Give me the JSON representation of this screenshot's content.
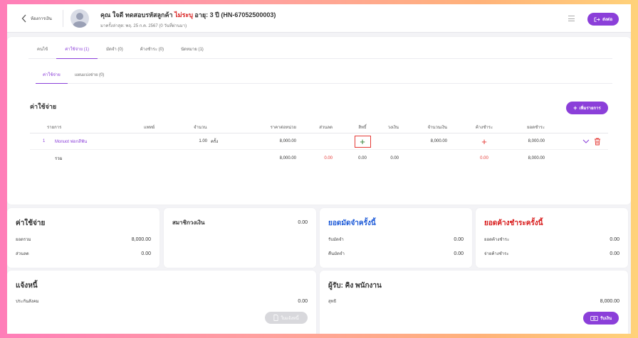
{
  "header": {
    "back_label": "ห้องการเงิน",
    "patient_name_prefix": "คุณ ใจดี ทดสอบรหัสลูกค้า ",
    "patient_flag": "ไม่ระบุ",
    "patient_name_suffix": " อายุ: 3 ปี (HN-67052500003)",
    "last_visit": "มาครั้งล่าสุด: พฤ. 25 ก.ค. 2567 (0 วันที่ผ่านมา)",
    "send_label": "ส่งต่อ"
  },
  "tabs_main": [
    {
      "label": "คนไข้"
    },
    {
      "label": "ค่าใช้จ่าย (1)"
    },
    {
      "label": "มัดจำ (0)"
    },
    {
      "label": "ค้างชำระ (0)"
    },
    {
      "label": "นัดหมาย (1)"
    }
  ],
  "tabs_sub": [
    {
      "label": "ค่าใช้จ่าย"
    },
    {
      "label": "แผนแบ่งจ่าย (0)"
    }
  ],
  "expenses": {
    "title": "ค่าใช้จ่าย",
    "add_label": "เพิ่มรายการ",
    "columns": {
      "item": "รายการ",
      "doctor": "แพทย์",
      "qty": "จำนวน",
      "unit_price": "ราคาต่อหน่วย",
      "discount": "ส่วนลด",
      "rights": "สิทธิ์",
      "credit": "วงเงิน",
      "amount": "จำนวนเงิน",
      "outstanding": "ค้างชำระ",
      "net": "ยอดชำระ"
    },
    "rows": [
      {
        "index": "1",
        "item": "Monuot ฟอกสีฟัน",
        "doctor": "",
        "qty": "1.00",
        "unit": "ครั้ง",
        "unit_price": "8,000.00",
        "discount": "",
        "credit": "",
        "amount": "8,000.00",
        "net": "8,000.00"
      }
    ],
    "total": {
      "label": "รวม",
      "unit_price": "8,000.00",
      "discount": "0.00",
      "rights": "0.00",
      "credit": "0.00",
      "outstanding": "0.00",
      "net": "8,000.00"
    }
  },
  "summary_expenses": {
    "title": "ค่าใช้จ่าย",
    "gross_label": "ยอดรวม",
    "gross": "8,000.00",
    "discount_label": "ส่วนลด",
    "discount": "0.00"
  },
  "member_credit": {
    "title": "สมาชิกวงเงิน",
    "value": "0.00"
  },
  "deposit": {
    "title": "ยอดมัดจำครั้งนี้",
    "receive_label": "รับมัดจำ",
    "receive": "0.00",
    "refund_label": "คืนมัดจำ",
    "refund": "0.00"
  },
  "outstanding": {
    "title": "ยอดค้างชำระครั้งนี้",
    "owed_label": "ยอดค้างชำระ",
    "owed": "0.00",
    "paid_label": "จ่ายค้างชำระ",
    "paid": "0.00"
  },
  "debt": {
    "title": "แจ้งหนี้",
    "insurance_label": "ประกันสังคม",
    "insurance": "0.00",
    "button_label": "ใบแจ้งหนี้"
  },
  "receiver": {
    "title": "ผู้รับ: คิง พนักงาน",
    "net_label": "สุทธิ",
    "net": "8,000.00",
    "button_label": "รับเงิน"
  },
  "colors": {
    "accent": "#8b3fd9",
    "danger": "#e53935",
    "blue": "#1e5bd8"
  }
}
